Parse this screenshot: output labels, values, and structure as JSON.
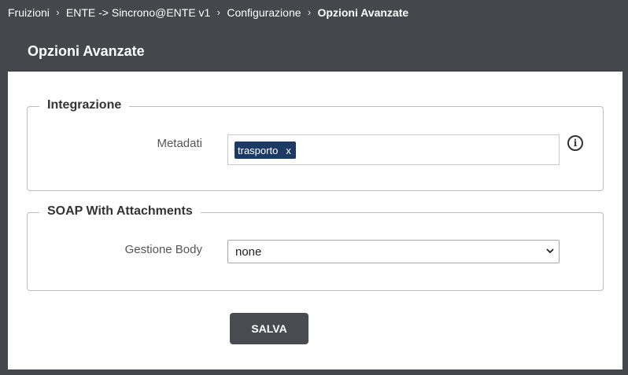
{
  "breadcrumb": {
    "items": [
      "Fruizioni",
      "ENTE -> Sincrono@ENTE v1",
      "Configurazione"
    ],
    "current": "Opzioni Avanzate"
  },
  "header": {
    "title": "Opzioni Avanzate"
  },
  "integrazione": {
    "legend": "Integrazione",
    "metadati_label": "Metadati",
    "tags": [
      {
        "label": "trasporto",
        "remove": "x"
      }
    ],
    "info_icon": "info-icon"
  },
  "soap": {
    "legend": "SOAP With Attachments",
    "gestione_body_label": "Gestione Body",
    "gestione_body_value": "none"
  },
  "actions": {
    "save_label": "SALVA"
  },
  "colors": {
    "page_background": "#46464d",
    "tag_background": "#1c3a64",
    "button_background": "#4a4a51"
  }
}
